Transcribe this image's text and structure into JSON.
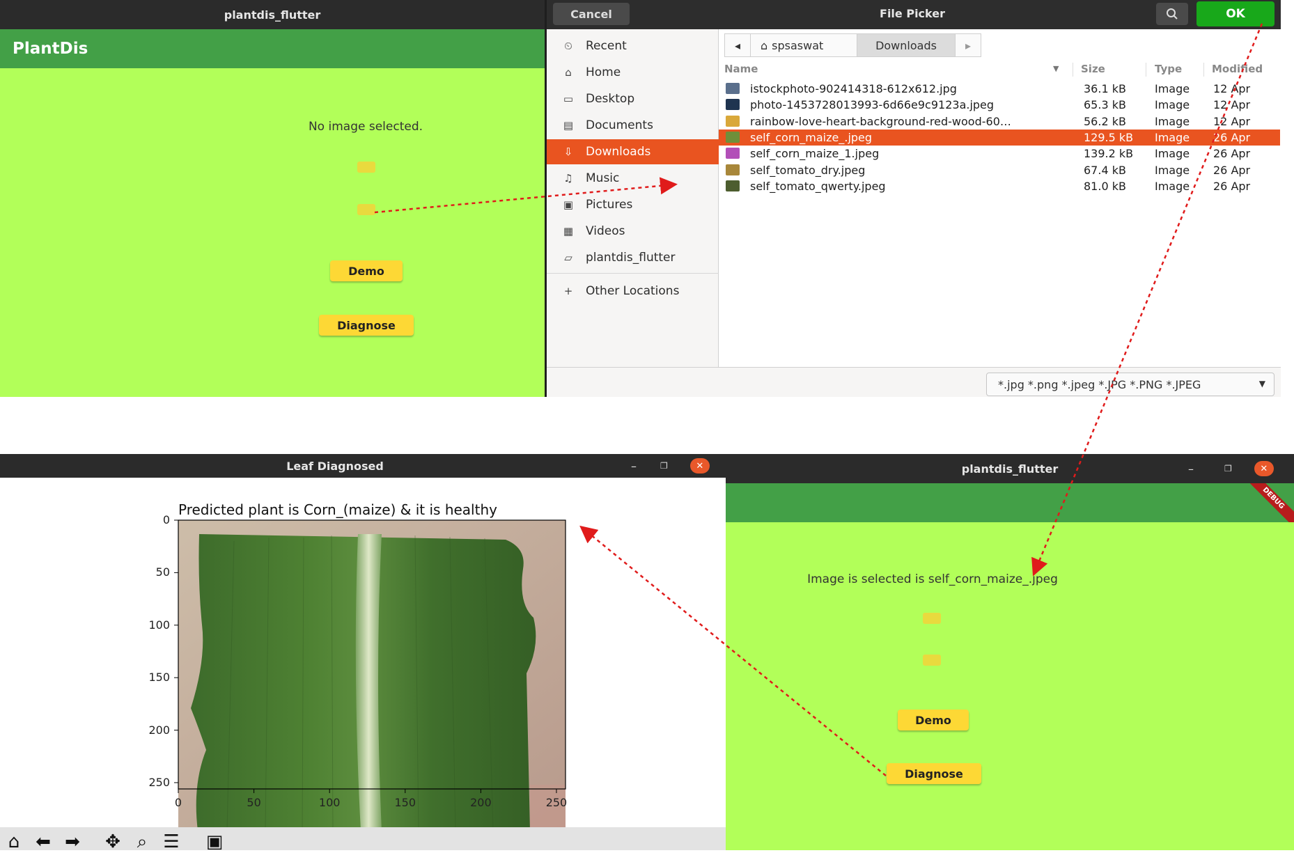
{
  "app1": {
    "window_title": "plantdis_flutter",
    "appbar_title": "PlantDis",
    "status_text": "No image selected.",
    "demo_label": "Demo",
    "diagnose_label": "Diagnose"
  },
  "file_picker": {
    "title": "File Picker",
    "cancel_label": "Cancel",
    "ok_label": "OK",
    "search_icon": "search-icon",
    "sidebar": [
      {
        "label": "Recent",
        "icon": "clock-icon",
        "glyph": "⏲"
      },
      {
        "label": "Home",
        "icon": "home-icon",
        "glyph": "⌂"
      },
      {
        "label": "Desktop",
        "icon": "desktop-icon",
        "glyph": "▭"
      },
      {
        "label": "Documents",
        "icon": "documents-icon",
        "glyph": "▤"
      },
      {
        "label": "Downloads",
        "icon": "download-icon",
        "glyph": "⇩"
      },
      {
        "label": "Music",
        "icon": "music-icon",
        "glyph": "♫"
      },
      {
        "label": "Pictures",
        "icon": "pictures-icon",
        "glyph": "▣"
      },
      {
        "label": "Videos",
        "icon": "videos-icon",
        "glyph": "▦"
      },
      {
        "label": "plantdis_flutter",
        "icon": "folder-icon",
        "glyph": "▱"
      },
      {
        "label": "Other Locations",
        "icon": "plus-icon",
        "glyph": "+"
      }
    ],
    "selected_sidebar": "Downloads",
    "breadcrumb": {
      "home": "spsaswat",
      "current": "Downloads"
    },
    "columns": {
      "name": "Name",
      "size": "Size",
      "type": "Type",
      "modified": "Modified"
    },
    "files": [
      {
        "name": "istockphoto-902414318-612x612.jpg",
        "size": "36.1 kB",
        "type": "Image",
        "modified": "12 Apr",
        "thumb": "#5a6f8c"
      },
      {
        "name": "photo-1453728013993-6d66e9c9123a.jpeg",
        "size": "65.3 kB",
        "type": "Image",
        "modified": "12 Apr",
        "thumb": "#1f3450"
      },
      {
        "name": "rainbow-love-heart-background-red-wood-60…",
        "size": "56.2 kB",
        "type": "Image",
        "modified": "12 Apr",
        "thumb": "#d9a83a"
      },
      {
        "name": "self_corn_maize_.jpeg",
        "size": "129.5 kB",
        "type": "Image",
        "modified": "26 Apr",
        "thumb": "#6f8f3a"
      },
      {
        "name": "self_corn_maize_1.jpeg",
        "size": "139.2 kB",
        "type": "Image",
        "modified": "26 Apr",
        "thumb": "#b24fb8"
      },
      {
        "name": "self_tomato_dry.jpeg",
        "size": "67.4 kB",
        "type": "Image",
        "modified": "26 Apr",
        "thumb": "#a8873a"
      },
      {
        "name": "self_tomato_qwerty.jpeg",
        "size": "81.0 kB",
        "type": "Image",
        "modified": "26 Apr",
        "thumb": "#4d5d2f"
      }
    ],
    "selected_file": "self_corn_maize_.jpeg",
    "filter": "*.jpg *.png *.jpeg *.JPG *.PNG *.JPEG"
  },
  "plot_window": {
    "title": "Leaf Diagnosed",
    "plot_title": "Predicted plant is Corn_(maize) & it is healthy",
    "toolbar": [
      "home-icon",
      "back-arrow-icon",
      "forward-arrow-icon",
      "pan-icon",
      "zoom-icon",
      "configure-icon",
      "save-icon"
    ]
  },
  "chart_data": {
    "type": "image",
    "title": "Predicted plant is Corn_(maize) & it is healthy",
    "x_ticks": [
      0,
      50,
      100,
      150,
      200,
      250
    ],
    "y_ticks": [
      0,
      50,
      100,
      150,
      200,
      250
    ],
    "xlim": [
      0,
      256
    ],
    "ylim": [
      256,
      0
    ]
  },
  "app2": {
    "window_title": "plantdis_flutter",
    "debug_label": "DEBUG",
    "status_text": "Image is selected is self_corn_maize_.jpeg",
    "demo_label": "Demo",
    "diagnose_label": "Diagnose"
  },
  "colors": {
    "arrow": "#e01b1b",
    "lime": "#b2ff59",
    "appbar": "#43a047",
    "accent": "#e95420",
    "ok": "#18a81a"
  }
}
